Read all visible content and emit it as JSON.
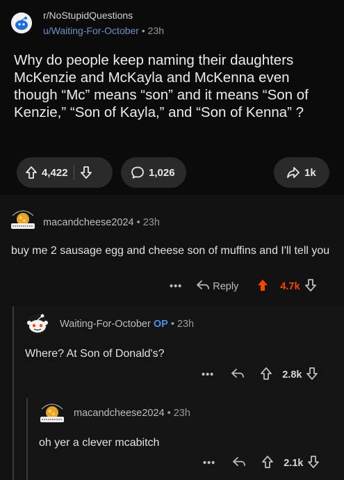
{
  "post": {
    "subreddit": "r/NoStupidQuestions",
    "author": "u/Waiting-For-October",
    "time_sep": " • ",
    "age": "23h",
    "title": "Why do people keep naming their daughters McKenzie and McKayla and McKenna even though “Mc” means “son” and it means “Son of Kenzie,” “Son of Kayla,” and “Son of Kenna” ?",
    "upvotes": "4,422",
    "comments": "1,026",
    "shares": "1k"
  },
  "comments": [
    {
      "username": "macandcheese2024",
      "age": " • 23h",
      "body": "buy me 2 sausage egg and cheese son of muffins and I'll tell you",
      "more": "•••",
      "reply_label": "Reply",
      "score": "4.7k",
      "upvoted": true,
      "avatar_icon": "mac-and-cheese-enthusiast-badge"
    },
    {
      "username": "Waiting-For-October",
      "op_badge": "OP",
      "age": " • 23h",
      "body": "Where? At Son of Donald's?",
      "more": "•••",
      "score": "2.8k",
      "avatar_icon": "snoo-avatar"
    },
    {
      "username": "macandcheese2024",
      "age": " • 23h",
      "body": "oh yer a clever mcabitch",
      "more": "•••",
      "score": "2.1k",
      "avatar_icon": "mac-and-cheese-enthusiast-badge"
    }
  ],
  "colors": {
    "upvote_active": "#ff4500",
    "op": "#4d8ee8",
    "author_link": "#6f8fc7"
  }
}
